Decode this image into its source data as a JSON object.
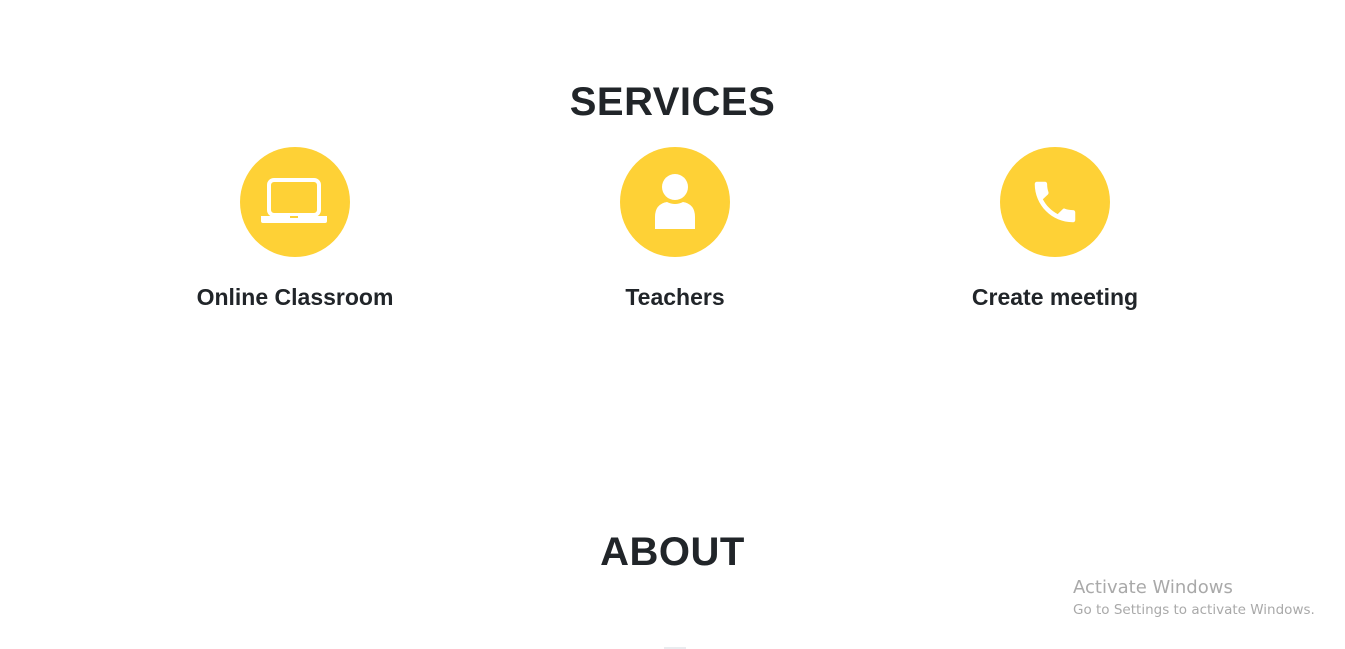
{
  "services": {
    "title": "SERVICES",
    "accent_color": "#fed136",
    "items": [
      {
        "label": "Online Classroom",
        "icon": "laptop-icon"
      },
      {
        "label": "Teachers",
        "icon": "user-icon"
      },
      {
        "label": "Create meeting",
        "icon": "phone-icon"
      }
    ]
  },
  "about": {
    "title": "ABOUT"
  },
  "watermark": {
    "title": "Activate Windows",
    "subtitle": "Go to Settings to activate Windows."
  }
}
